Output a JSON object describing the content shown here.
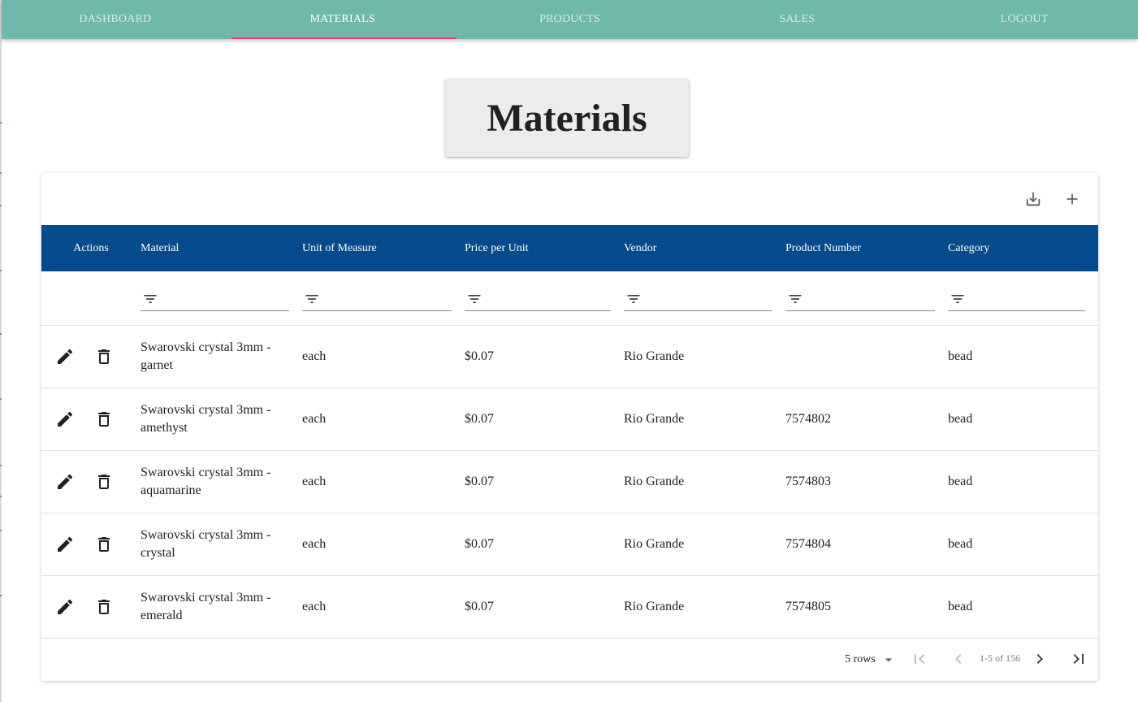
{
  "nav": {
    "tabs": [
      {
        "label": "DASHBOARD"
      },
      {
        "label": "MATERIALS"
      },
      {
        "label": "PRODUCTS"
      },
      {
        "label": "SALES"
      },
      {
        "label": "LOGOUT"
      }
    ],
    "active_index": 1
  },
  "page": {
    "title": "Materials"
  },
  "colors": {
    "nav_bg": "#70b8ac",
    "nav_indicator": "#e0457b",
    "table_header_bg": "#054a8b",
    "title_box_bg": "#ececec"
  },
  "toolbar": {
    "export_icon": "download-icon",
    "add_icon": "add-icon"
  },
  "table": {
    "columns": [
      "Actions",
      "Material",
      "Unit of Measure",
      "Price per Unit",
      "Vendor",
      "Product Number",
      "Category"
    ],
    "filter_icon": "filter-icon",
    "rows": [
      {
        "material": "Swarovski crystal 3mm - garnet",
        "unit": "each",
        "price": "$0.07",
        "vendor": "Rio Grande",
        "product_number": "",
        "category": "bead"
      },
      {
        "material": "Swarovski crystal 3mm - amethyst",
        "unit": "each",
        "price": "$0.07",
        "vendor": "Rio Grande",
        "product_number": "7574802",
        "category": "bead"
      },
      {
        "material": "Swarovski crystal 3mm - aquamarine",
        "unit": "each",
        "price": "$0.07",
        "vendor": "Rio Grande",
        "product_number": "7574803",
        "category": "bead"
      },
      {
        "material": "Swarovski crystal 3mm - crystal",
        "unit": "each",
        "price": "$0.07",
        "vendor": "Rio Grande",
        "product_number": "7574804",
        "category": "bead"
      },
      {
        "material": "Swarovski crystal 3mm - emerald",
        "unit": "each",
        "price": "$0.07",
        "vendor": "Rio Grande",
        "product_number": "7574805",
        "category": "bead"
      }
    ]
  },
  "pagination": {
    "rows_per_page": "5 rows",
    "page_info": "1-5 of 156"
  }
}
